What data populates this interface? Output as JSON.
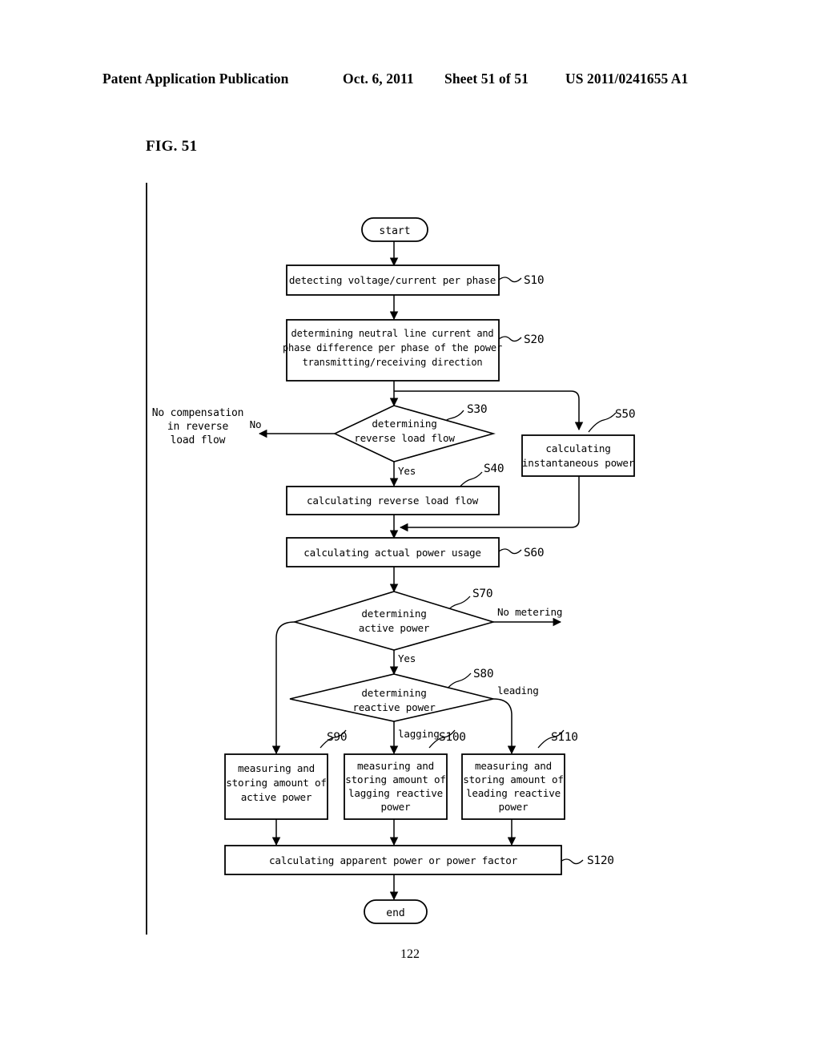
{
  "header": {
    "publication": "Patent Application Publication",
    "date": "Oct. 6, 2011",
    "sheet": "Sheet 51 of 51",
    "patent_number": "US 2011/0241655 A1"
  },
  "figure": {
    "label": "FIG. 51",
    "page_number": "122"
  },
  "flowchart": {
    "nodes": {
      "start": {
        "text": "start",
        "ref": ""
      },
      "s10": {
        "lines": [
          "detecting voltage/current per phase"
        ],
        "ref": "S10"
      },
      "s20": {
        "lines": [
          "determining neutral line current and",
          "phase difference per phase of the power",
          "transmitting/receiving direction"
        ],
        "ref": "S20"
      },
      "s30": {
        "lines": [
          "determining",
          "reverse load flow"
        ],
        "ref": "S30"
      },
      "s40": {
        "lines": [
          "calculating reverse load flow"
        ],
        "ref": "S40"
      },
      "s50": {
        "lines": [
          "calculating",
          "instantaneous power"
        ],
        "ref": "S50"
      },
      "s60": {
        "lines": [
          "calculating actual power usage"
        ],
        "ref": "S60"
      },
      "s70": {
        "lines": [
          "determining",
          "active power"
        ],
        "ref": "S70"
      },
      "s80": {
        "lines": [
          "determining",
          "reactive power"
        ],
        "ref": "S80"
      },
      "s90": {
        "lines": [
          "measuring and",
          "storing amount of",
          "active power"
        ],
        "ref": "S90"
      },
      "s100": {
        "lines": [
          "measuring and",
          "storing amount of",
          "lagging reactive",
          "power"
        ],
        "ref": "S100"
      },
      "s110": {
        "lines": [
          "measuring and",
          "storing amount of",
          "leading reactive",
          "power"
        ],
        "ref": "S110"
      },
      "s120": {
        "lines": [
          "calculating apparent power or power factor"
        ],
        "ref": "S120"
      },
      "end": {
        "text": "end",
        "ref": ""
      }
    },
    "branch_labels": {
      "s30_no": "No",
      "s30_yes": "Yes",
      "s70_yes": "Yes",
      "s70_no_metering": "No metering",
      "s80_lagging": "lagging",
      "s80_leading": "leading"
    },
    "annotations": {
      "no_compensation": [
        "No compensation",
        "in reverse",
        "load flow"
      ]
    }
  },
  "colors": {
    "ink": "#000000",
    "paper": "#ffffff"
  }
}
